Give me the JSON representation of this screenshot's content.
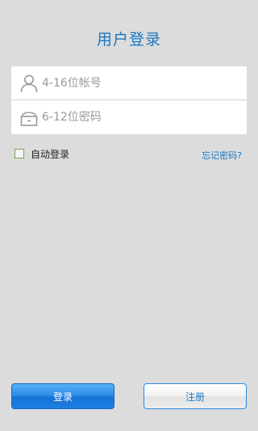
{
  "header": {
    "title": "用户登录"
  },
  "form": {
    "account_placeholder": "4-16位帐号",
    "password_placeholder": "6-12位密码",
    "account_icon": "user-icon",
    "password_icon": "lock-icon"
  },
  "options": {
    "auto_login_label": "自动登录",
    "auto_login_checked": false,
    "forgot_password": "忘记密码?"
  },
  "actions": {
    "login_label": "登录",
    "register_label": "注册"
  },
  "colors": {
    "accent": "#1a78c2",
    "background": "#dcdcdc",
    "login_button": "#2a8be6"
  }
}
